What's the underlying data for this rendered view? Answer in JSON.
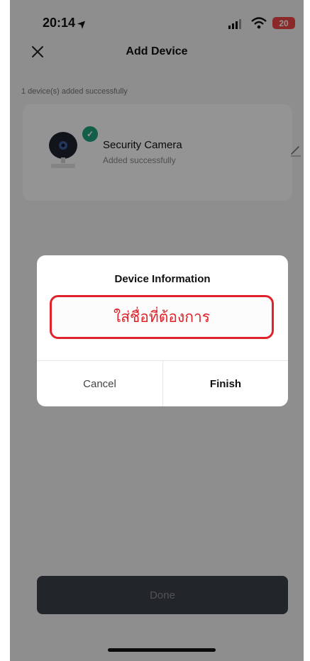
{
  "status_bar": {
    "time": "20:14",
    "battery": "20"
  },
  "nav": {
    "title": "Add Device"
  },
  "summary": {
    "added_count_text": "1 device(s) added successfully"
  },
  "device": {
    "name": "Security Camera",
    "status": "Added successfully"
  },
  "dialog": {
    "title": "Device Information",
    "name_input_value": "ใส่ชื่อที่ต้องการ",
    "cancel_label": "Cancel",
    "finish_label": "Finish"
  },
  "footer": {
    "done_label": "Done"
  },
  "colors": {
    "accent_check": "#1fa37c",
    "highlight_red": "#e0232a",
    "battery": "#f04848",
    "done_button": "#3c4047"
  },
  "icons": [
    "location-arrow-icon",
    "signal-icon",
    "wifi-icon",
    "battery-icon",
    "close-icon",
    "checkmark-icon",
    "camera-icon",
    "edit-pencil-icon"
  ]
}
